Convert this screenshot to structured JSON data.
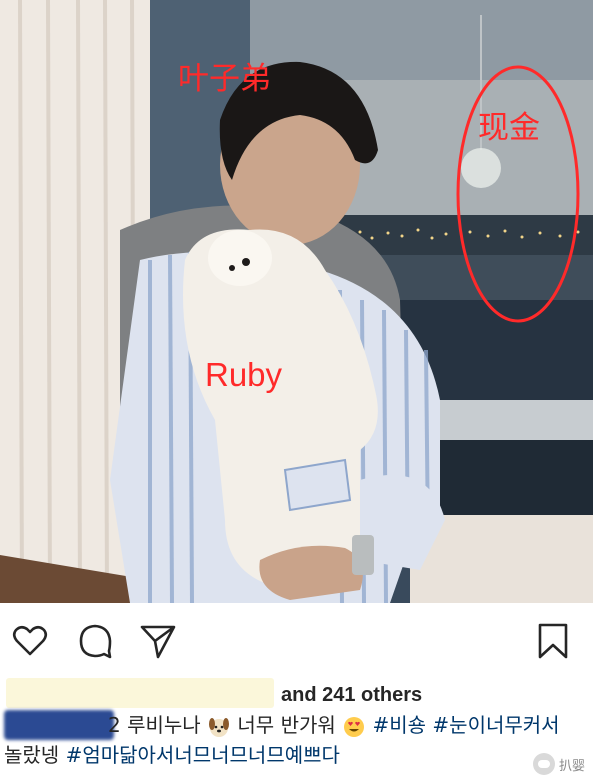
{
  "photo": {
    "annotations": {
      "name_label": "叶子弟",
      "cash_label": "现金",
      "dog_label": "Ruby"
    },
    "annotation_color": "#ff2a2a"
  },
  "actions": {
    "like_icon": "heart-icon",
    "comment_icon": "comment-icon",
    "share_icon": "send-icon",
    "save_icon": "bookmark-icon"
  },
  "likes": {
    "others_text": "and 241 others"
  },
  "caption": {
    "line1_prefix": "2 루비누나",
    "line1_mid": " 너무 반가워",
    "tag1": "#비숑",
    "tag2": "#눈이너무커서",
    "line2_text": "놀랐넹 ",
    "tag3": "#엄마닮아서너므너므너므예쁘다"
  },
  "watermark": {
    "text": "扒婴"
  }
}
